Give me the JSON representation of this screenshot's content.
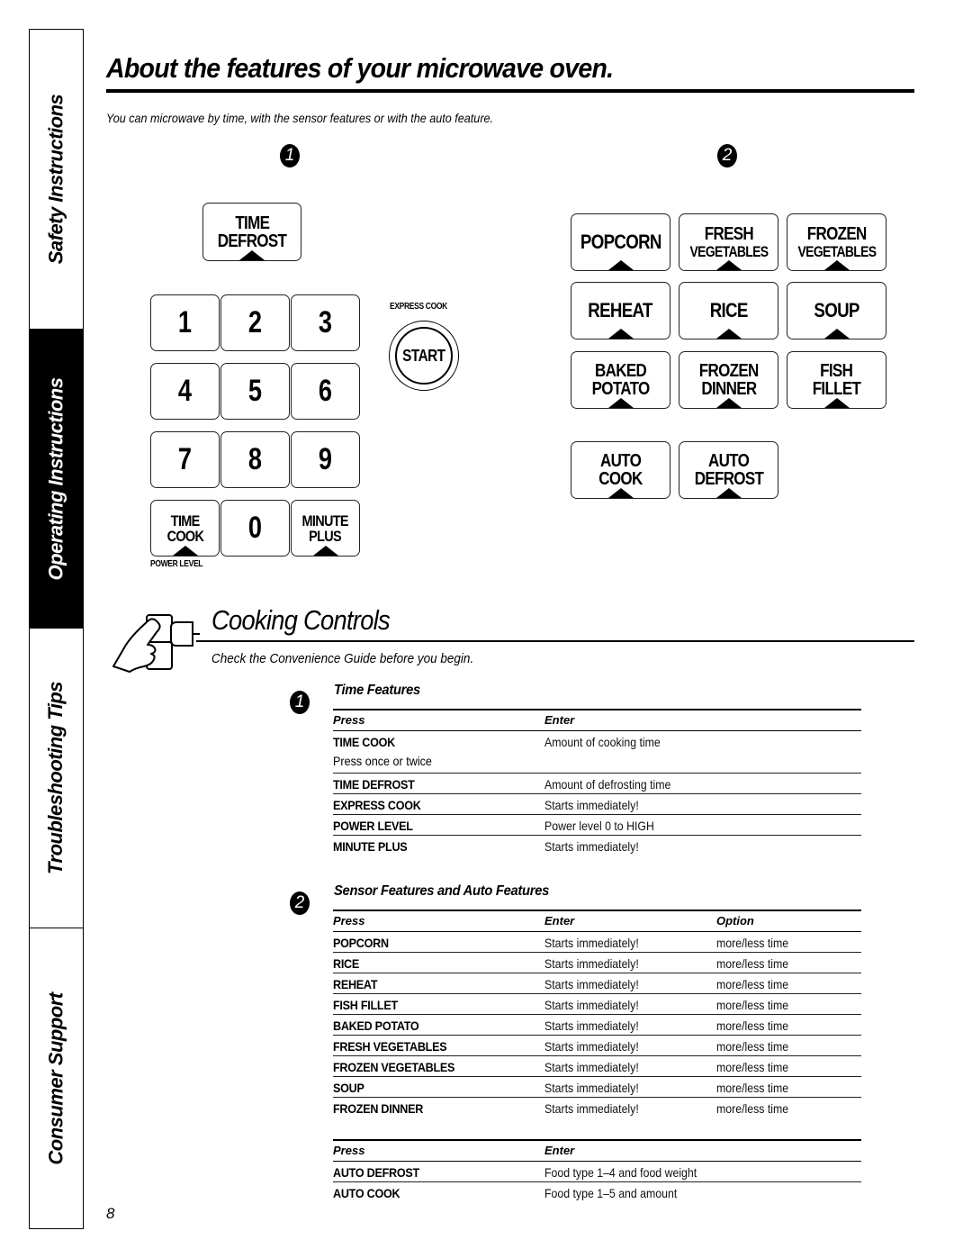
{
  "sidebar": {
    "tabs": [
      {
        "label": "Safety Instructions",
        "active": false
      },
      {
        "label": "Operating Instructions",
        "active": true
      },
      {
        "label": "Troubleshooting Tips",
        "active": false
      },
      {
        "label": "Consumer Support",
        "active": false
      }
    ]
  },
  "header": {
    "title": "About the features of your microwave oven.",
    "intro": "You can microwave by time, with the sensor features or with the auto feature."
  },
  "badges": {
    "one": "1",
    "two": "2"
  },
  "keypad": {
    "time_defrost": [
      "TIME",
      "DEFROST"
    ],
    "digits": [
      "1",
      "2",
      "3",
      "4",
      "5",
      "6",
      "7",
      "8",
      "9",
      "0"
    ],
    "time_cook": [
      "TIME",
      "COOK"
    ],
    "minute_plus": [
      "MINUTE",
      "PLUS"
    ],
    "power_level_label": "POWER LEVEL",
    "express_cook_label": "EXPRESS COOK",
    "start_label": "START"
  },
  "sensor_keys": {
    "popcorn": "POPCORN",
    "fresh_vegetables": [
      "FRESH",
      "VEGETABLES"
    ],
    "frozen_vegetables": [
      "FROZEN",
      "VEGETABLES"
    ],
    "reheat": "REHEAT",
    "rice": "RICE",
    "soup": "SOUP",
    "baked_potato": [
      "BAKED",
      "POTATO"
    ],
    "frozen_dinner": [
      "FROZEN",
      "DINNER"
    ],
    "fish_fillet": [
      "FISH",
      "FILLET"
    ],
    "auto_cook": [
      "AUTO",
      "COOK"
    ],
    "auto_defrost": [
      "AUTO",
      "DEFROST"
    ]
  },
  "cooking_controls": {
    "title": "Cooking Controls",
    "subtitle": "Check the Convenience Guide before you begin."
  },
  "time_features": {
    "heading": "Time Features",
    "columns": [
      "Press",
      "Enter"
    ],
    "rows": [
      {
        "press": "TIME COOK",
        "note": "Press once or twice",
        "enter": "Amount of cooking time"
      },
      {
        "press": "TIME DEFROST",
        "enter": "Amount of defrosting time"
      },
      {
        "press": "EXPRESS COOK",
        "enter": "Starts immediately!"
      },
      {
        "press": "POWER LEVEL",
        "enter": "Power level 0 to HIGH"
      },
      {
        "press": "MINUTE PLUS",
        "enter": "Starts immediately!"
      }
    ]
  },
  "sensor_features": {
    "heading": "Sensor Features and Auto Features",
    "columns": [
      "Press",
      "Enter",
      "Option"
    ],
    "rows": [
      {
        "press": "POPCORN",
        "enter": "Starts immediately!",
        "option": "more/less time"
      },
      {
        "press": "RICE",
        "enter": "Starts immediately!",
        "option": "more/less time"
      },
      {
        "press": "REHEAT",
        "enter": "Starts immediately!",
        "option": "more/less time"
      },
      {
        "press": "FISH FILLET",
        "enter": "Starts immediately!",
        "option": "more/less time"
      },
      {
        "press": "BAKED POTATO",
        "enter": "Starts immediately!",
        "option": "more/less time"
      },
      {
        "press": "FRESH VEGETABLES",
        "enter": "Starts immediately!",
        "option": "more/less time"
      },
      {
        "press": "FROZEN VEGETABLES",
        "enter": "Starts immediately!",
        "option": "more/less time"
      },
      {
        "press": "SOUP",
        "enter": "Starts immediately!",
        "option": "more/less time"
      },
      {
        "press": "FROZEN DINNER",
        "enter": "Starts immediately!",
        "option": "more/less time"
      }
    ]
  },
  "auto_features": {
    "columns": [
      "Press",
      "Enter"
    ],
    "rows": [
      {
        "press": "AUTO DEFROST",
        "enter": "Food type 1–4 and food weight"
      },
      {
        "press": "AUTO COOK",
        "enter": "Food type 1–5 and amount"
      }
    ]
  },
  "page_number": "8"
}
